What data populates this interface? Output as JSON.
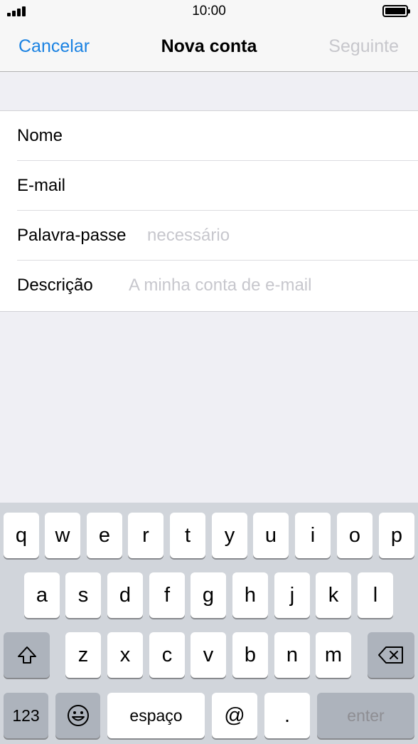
{
  "status": {
    "time": "10:00"
  },
  "nav": {
    "cancel": "Cancelar",
    "title": "Nova conta",
    "next": "Seguinte"
  },
  "form": {
    "rows": [
      {
        "label": "Nome",
        "placeholder": ""
      },
      {
        "label": "E-mail",
        "placeholder": ""
      },
      {
        "label": "Palavra-passe",
        "placeholder": "necessário"
      },
      {
        "label": "Descrição",
        "placeholder": "A minha conta de e-mail"
      }
    ]
  },
  "keyboard": {
    "row1": [
      "q",
      "w",
      "e",
      "r",
      "t",
      "y",
      "u",
      "i",
      "o",
      "p"
    ],
    "row2": [
      "a",
      "s",
      "d",
      "f",
      "g",
      "h",
      "j",
      "k",
      "l"
    ],
    "row3": [
      "z",
      "x",
      "c",
      "v",
      "b",
      "n",
      "m"
    ],
    "numbers": "123",
    "space": "espaço",
    "at": "@",
    "dot": ".",
    "enter": "enter",
    "icons": {
      "shift": "shift-icon",
      "delete": "backspace-icon",
      "emoji": "emoji-icon"
    }
  }
}
